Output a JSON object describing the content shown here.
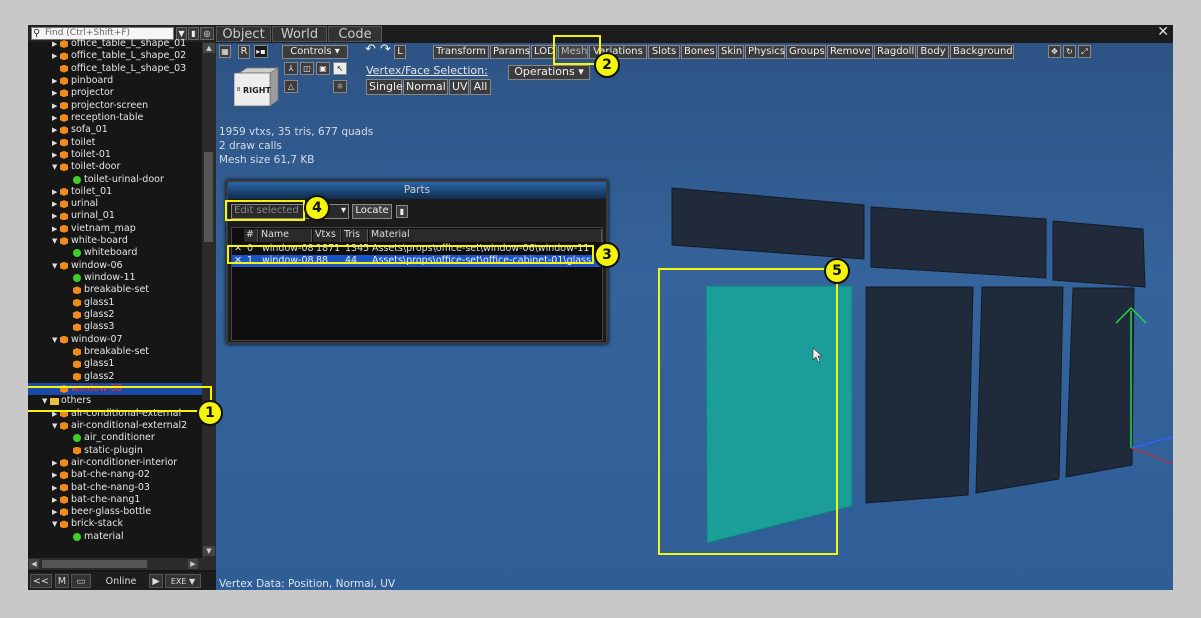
{
  "outliner": {
    "search_placeholder": "Find (Ctrl+Shift+F)",
    "rows": [
      {
        "label": "office_table_L_shape_01",
        "icon": "object",
        "level": 2,
        "arrow": "collapsed"
      },
      {
        "label": "office_table_L_shape_02",
        "icon": "object",
        "level": 2,
        "arrow": "collapsed"
      },
      {
        "label": "office_table_L_shape_03",
        "icon": "object",
        "level": 2,
        "arrow": "none"
      },
      {
        "label": "pinboard",
        "icon": "object",
        "level": 2,
        "arrow": "collapsed"
      },
      {
        "label": "projector",
        "icon": "object",
        "level": 2,
        "arrow": "collapsed"
      },
      {
        "label": "projector-screen",
        "icon": "object",
        "level": 2,
        "arrow": "collapsed"
      },
      {
        "label": "reception-table",
        "icon": "object",
        "level": 2,
        "arrow": "collapsed"
      },
      {
        "label": "sofa_01",
        "icon": "object",
        "level": 2,
        "arrow": "collapsed"
      },
      {
        "label": "toilet",
        "icon": "object",
        "level": 2,
        "arrow": "collapsed"
      },
      {
        "label": "toilet-01",
        "icon": "object",
        "level": 2,
        "arrow": "collapsed"
      },
      {
        "label": "toilet-door",
        "icon": "object",
        "level": 2,
        "arrow": "expanded"
      },
      {
        "label": "toilet-urinal-door",
        "icon": "mesh",
        "level": 3,
        "arrow": "none"
      },
      {
        "label": "toilet_01",
        "icon": "object",
        "level": 2,
        "arrow": "collapsed"
      },
      {
        "label": "urinal",
        "icon": "object",
        "level": 2,
        "arrow": "collapsed"
      },
      {
        "label": "urinal_01",
        "icon": "object",
        "level": 2,
        "arrow": "collapsed"
      },
      {
        "label": "vietnam_map",
        "icon": "object",
        "level": 2,
        "arrow": "collapsed"
      },
      {
        "label": "white-board",
        "icon": "object",
        "level": 2,
        "arrow": "expanded"
      },
      {
        "label": "whiteboard",
        "icon": "mesh",
        "level": 3,
        "arrow": "none"
      },
      {
        "label": "window-06",
        "icon": "object",
        "level": 2,
        "arrow": "expanded"
      },
      {
        "label": "window-11",
        "icon": "mesh",
        "level": 3,
        "arrow": "none"
      },
      {
        "label": "breakable-set",
        "icon": "object",
        "level": 3,
        "arrow": "none"
      },
      {
        "label": "glass1",
        "icon": "object",
        "level": 3,
        "arrow": "none"
      },
      {
        "label": "glass2",
        "icon": "object",
        "level": 3,
        "arrow": "none"
      },
      {
        "label": "glass3",
        "icon": "object",
        "level": 3,
        "arrow": "none"
      },
      {
        "label": "window-07",
        "icon": "object",
        "level": 2,
        "arrow": "expanded"
      },
      {
        "label": "breakable-set",
        "icon": "object",
        "level": 3,
        "arrow": "none"
      },
      {
        "label": "glass1",
        "icon": "object",
        "level": 3,
        "arrow": "none"
      },
      {
        "label": "glass2",
        "icon": "object",
        "level": 3,
        "arrow": "none"
      },
      {
        "label": "window-08",
        "icon": "object",
        "level": 2,
        "arrow": "none",
        "selected": true
      },
      {
        "label": "others",
        "icon": "folder",
        "level": 1,
        "arrow": "expanded"
      },
      {
        "label": "air-conditional-external",
        "icon": "object",
        "level": 2,
        "arrow": "collapsed"
      },
      {
        "label": "air-conditional-external2",
        "icon": "object",
        "level": 2,
        "arrow": "expanded"
      },
      {
        "label": "air_conditioner",
        "icon": "mesh",
        "level": 3,
        "arrow": "none"
      },
      {
        "label": "static-plugin",
        "icon": "object",
        "level": 3,
        "arrow": "none"
      },
      {
        "label": "air-conditioner-interior",
        "icon": "object",
        "level": 2,
        "arrow": "collapsed"
      },
      {
        "label": "bat-che-nang-02",
        "icon": "object",
        "level": 2,
        "arrow": "collapsed"
      },
      {
        "label": "bat-che-nang-03",
        "icon": "object",
        "level": 2,
        "arrow": "collapsed"
      },
      {
        "label": "bat-che-nang1",
        "icon": "object",
        "level": 2,
        "arrow": "collapsed"
      },
      {
        "label": "beer-glass-bottle",
        "icon": "object",
        "level": 2,
        "arrow": "collapsed"
      },
      {
        "label": "brick-stack",
        "icon": "object",
        "level": 2,
        "arrow": "expanded"
      },
      {
        "label": "material",
        "icon": "mesh",
        "level": 3,
        "arrow": "none"
      }
    ],
    "bottom_bar": {
      "back": "<<",
      "mode": "M",
      "online": "Online",
      "exe": "EXE"
    }
  },
  "main_tabs": [
    "Object",
    "World",
    "Code"
  ],
  "toolbar": {
    "r_label": "R",
    "controls_label": "Controls",
    "view_label": "RIGHT",
    "vertex_face_label": "Vertex/Face Selection:",
    "operations_label": "Operations",
    "l_label": "L",
    "selection_modes": [
      "Single",
      "Normal",
      "UV",
      "All"
    ],
    "mode_tabs": [
      "Transform",
      "Params",
      "LOD",
      "Mesh",
      "Variations",
      "Slots",
      "Bones",
      "Skin",
      "Physics",
      "Groups",
      "Remove",
      "Ragdoll",
      "Body",
      "Background"
    ]
  },
  "stats": {
    "line1": "1959 vtxs, 35 tris, 677 quads",
    "line2": "2 draw calls",
    "line3": "Mesh size 61,7 KB"
  },
  "parts_panel": {
    "title": "Parts",
    "edit_selected_label": "Edit selected",
    "locate_label": "Locate",
    "columns": [
      "#",
      "Name",
      "Vtxs",
      "Tris",
      "Material"
    ],
    "rows": [
      {
        "index": "0",
        "name": "window-08",
        "vtxs": "1871",
        "tris": "1345",
        "material": "Assets\\props\\office-set\\window-06\\window-11",
        "selected": false
      },
      {
        "index": "1",
        "name": "window-08",
        "vtxs": "88",
        "tris": "44",
        "material": "Assets\\props\\office-set\\office-cabinet-01\\glass",
        "selected": true
      }
    ]
  },
  "footer_text": "Vertex Data: Position, Normal, UV",
  "annotations": [
    "1",
    "2",
    "3",
    "4",
    "5"
  ],
  "colors": {
    "highlight": "#f4f40c",
    "selection": "#1a4aa8",
    "selected_text": "#ff2a2a",
    "glass_pane": "#1b9d9a"
  }
}
